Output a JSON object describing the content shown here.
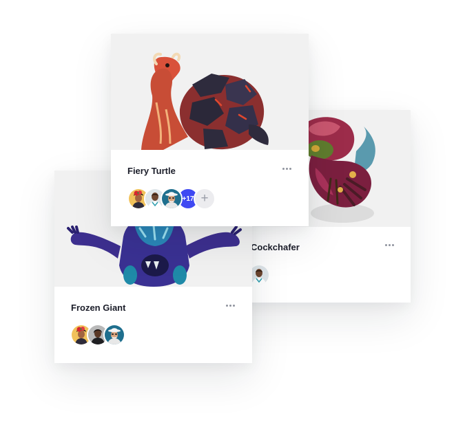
{
  "cards": {
    "cockchafer": {
      "title": "Cockchafer",
      "members": [
        "avatar-man-white-tee"
      ]
    },
    "frozen_giant": {
      "title": "Frozen Giant",
      "members": [
        "avatar-woman-red-flower",
        "avatar-woman-gray",
        "avatar-man-white-hat"
      ]
    },
    "fiery_turtle": {
      "title": "Fiery Turtle",
      "members": [
        "avatar-woman-red-flower",
        "avatar-man-white-tee",
        "avatar-man-white-hat"
      ],
      "extra_count": "+17"
    }
  },
  "colors": {
    "accent": "#3f49f2",
    "title": "#1b1d29",
    "image_bg": "#f1f1f1"
  }
}
